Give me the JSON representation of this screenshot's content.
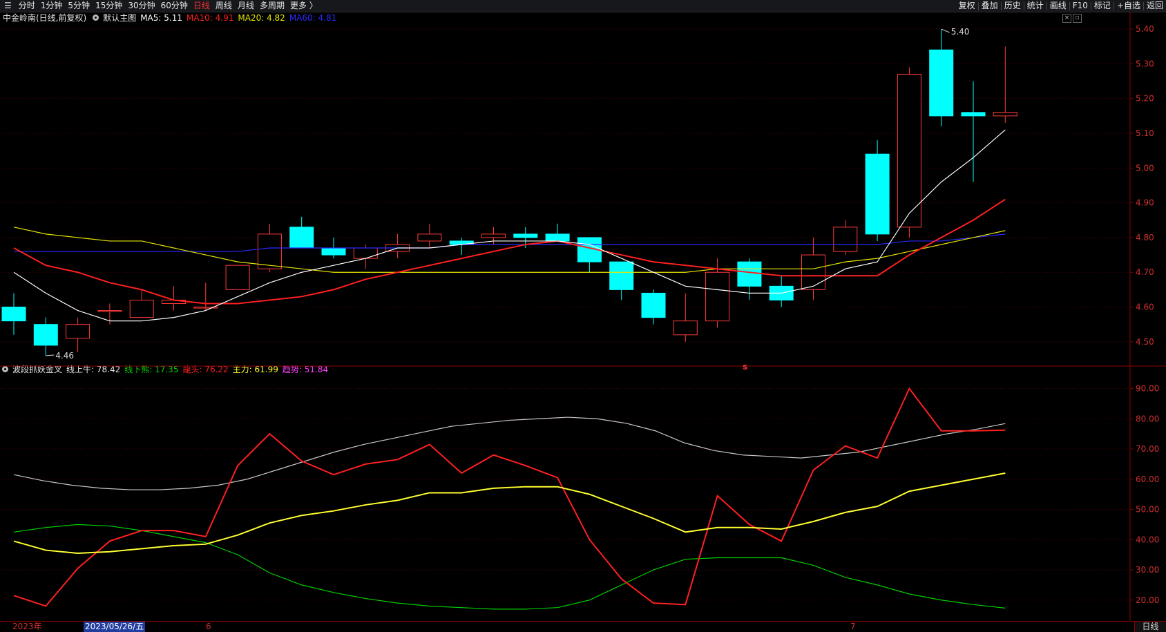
{
  "toolbar": {
    "periods": [
      "分时",
      "1分钟",
      "5分钟",
      "15分钟",
      "30分钟",
      "60分钟",
      "日线",
      "周线",
      "月线",
      "多周期",
      "更多 〉"
    ],
    "active_period": "日线",
    "tools": [
      "复权",
      "叠加",
      "历史",
      "统计",
      "画线",
      "F10",
      "标记",
      "+自选",
      "返回"
    ]
  },
  "main_panel": {
    "stock_label": "中金岭南(日线,前复权)",
    "indicator_name": "默认主图",
    "ma5": "MA5: 5.11",
    "ma10": "MA10: 4.91",
    "ma20": "MA20: 4.82",
    "ma60": "MA60: 4.81",
    "high_marker": "5.40",
    "low_marker": "4.46",
    "marker_s": "s",
    "y_ticks": [
      "5.40",
      "5.30",
      "5.20",
      "5.10",
      "5.00",
      "4.90",
      "4.80",
      "4.70",
      "4.60",
      "4.50"
    ]
  },
  "sub_panel": {
    "indicator_name": "波段抓妖金叉",
    "line_up": "线上牛: 78.42",
    "line_down": "线下熊: 17.35",
    "dragon_head": "龍头: 76.22",
    "main_force": "主力: 61.99",
    "trend": "趋势: 51.84",
    "y_ticks": [
      "90.00",
      "80.00",
      "70.00",
      "60.00",
      "50.00",
      "40.00",
      "30.00",
      "20.00"
    ]
  },
  "time_axis": {
    "year_label": "2023年",
    "cursor_date": "2023/05/26/五",
    "month_6": "6",
    "month_7": "7",
    "period_label": "日线"
  },
  "colors": {
    "up": "#ff3b3b",
    "down": "#00ffff",
    "ma5": "#ffffff",
    "ma10": "#ff2020",
    "ma20": "#e6e600",
    "ma60": "#2a2aff",
    "line_up": "#c8c8c8",
    "line_down": "#00d000",
    "dragon": "#ff2020",
    "main_force": "#ffff30",
    "trend": "#ff40ff"
  },
  "chart_data": [
    {
      "type": "candlestick",
      "title": "中金岭南(日线,前复权)",
      "ylim": [
        4.45,
        5.42
      ],
      "candles": [
        {
          "o": 4.6,
          "h": 4.64,
          "l": 4.52,
          "c": 4.56
        },
        {
          "o": 4.55,
          "h": 4.57,
          "l": 4.46,
          "c": 4.49
        },
        {
          "o": 4.51,
          "h": 4.57,
          "l": 4.47,
          "c": 4.55
        },
        {
          "o": 4.59,
          "h": 4.61,
          "l": 4.55,
          "c": 4.59
        },
        {
          "o": 4.57,
          "h": 4.65,
          "l": 4.57,
          "c": 4.62
        },
        {
          "o": 4.61,
          "h": 4.66,
          "l": 4.59,
          "c": 4.62
        },
        {
          "o": 4.6,
          "h": 4.67,
          "l": 4.59,
          "c": 4.6
        },
        {
          "o": 4.65,
          "h": 4.72,
          "l": 4.65,
          "c": 4.72
        },
        {
          "o": 4.71,
          "h": 4.84,
          "l": 4.7,
          "c": 4.81
        },
        {
          "o": 4.83,
          "h": 4.86,
          "l": 4.77,
          "c": 4.77
        },
        {
          "o": 4.77,
          "h": 4.8,
          "l": 4.74,
          "c": 4.75
        },
        {
          "o": 4.74,
          "h": 4.78,
          "l": 4.71,
          "c": 4.77
        },
        {
          "o": 4.76,
          "h": 4.81,
          "l": 4.74,
          "c": 4.78
        },
        {
          "o": 4.79,
          "h": 4.84,
          "l": 4.77,
          "c": 4.81
        },
        {
          "o": 4.79,
          "h": 4.8,
          "l": 4.75,
          "c": 4.78
        },
        {
          "o": 4.8,
          "h": 4.83,
          "l": 4.78,
          "c": 4.81
        },
        {
          "o": 4.81,
          "h": 4.83,
          "l": 4.77,
          "c": 4.8
        },
        {
          "o": 4.81,
          "h": 4.84,
          "l": 4.79,
          "c": 4.79
        },
        {
          "o": 4.8,
          "h": 4.8,
          "l": 4.7,
          "c": 4.73
        },
        {
          "o": 4.73,
          "h": 4.73,
          "l": 4.62,
          "c": 4.65
        },
        {
          "o": 4.64,
          "h": 4.65,
          "l": 4.55,
          "c": 4.57
        },
        {
          "o": 4.52,
          "h": 4.64,
          "l": 4.5,
          "c": 4.56
        },
        {
          "o": 4.56,
          "h": 4.74,
          "l": 4.54,
          "c": 4.7
        },
        {
          "o": 4.73,
          "h": 4.74,
          "l": 4.62,
          "c": 4.66
        },
        {
          "o": 4.66,
          "h": 4.69,
          "l": 4.6,
          "c": 4.62
        },
        {
          "o": 4.65,
          "h": 4.8,
          "l": 4.62,
          "c": 4.75
        },
        {
          "o": 4.76,
          "h": 4.85,
          "l": 4.75,
          "c": 4.83
        },
        {
          "o": 5.04,
          "h": 5.08,
          "l": 4.79,
          "c": 4.81
        },
        {
          "o": 4.83,
          "h": 5.29,
          "l": 4.8,
          "c": 5.27
        },
        {
          "o": 5.34,
          "h": 5.4,
          "l": 5.12,
          "c": 5.15
        },
        {
          "o": 5.16,
          "h": 5.25,
          "l": 4.96,
          "c": 5.15
        },
        {
          "o": 5.15,
          "h": 5.35,
          "l": 5.13,
          "c": 5.16
        }
      ],
      "ma5": [
        4.7,
        4.64,
        4.59,
        4.56,
        4.56,
        4.57,
        4.59,
        4.63,
        4.67,
        4.7,
        4.72,
        4.74,
        4.77,
        4.77,
        4.78,
        4.79,
        4.79,
        4.79,
        4.78,
        4.74,
        4.7,
        4.66,
        4.65,
        4.64,
        4.64,
        4.66,
        4.71,
        4.73,
        4.87,
        4.96,
        5.03,
        5.11
      ],
      "ma10": [
        4.77,
        4.72,
        4.7,
        4.67,
        4.65,
        4.62,
        4.61,
        4.61,
        4.62,
        4.63,
        4.65,
        4.68,
        4.7,
        4.72,
        4.74,
        4.76,
        4.78,
        4.79,
        4.77,
        4.75,
        4.73,
        4.72,
        4.71,
        4.7,
        4.69,
        4.69,
        4.69,
        4.69,
        4.75,
        4.8,
        4.85,
        4.91
      ],
      "ma20": [
        4.83,
        4.81,
        4.8,
        4.79,
        4.79,
        4.77,
        4.75,
        4.73,
        4.72,
        4.71,
        4.7,
        4.7,
        4.7,
        4.7,
        4.7,
        4.7,
        4.7,
        4.7,
        4.7,
        4.7,
        4.7,
        4.7,
        4.71,
        4.71,
        4.71,
        4.71,
        4.73,
        4.74,
        4.76,
        4.78,
        4.8,
        4.82
      ],
      "ma60": [
        4.76,
        4.76,
        4.76,
        4.76,
        4.76,
        4.76,
        4.76,
        4.76,
        4.77,
        4.77,
        4.77,
        4.77,
        4.77,
        4.77,
        4.78,
        4.78,
        4.78,
        4.78,
        4.78,
        4.78,
        4.78,
        4.78,
        4.78,
        4.78,
        4.78,
        4.78,
        4.78,
        4.78,
        4.79,
        4.79,
        4.8,
        4.81
      ]
    },
    {
      "type": "line",
      "title": "波段抓妖金叉",
      "ylim": [
        14,
        94
      ],
      "series": [
        {
          "name": "线上牛",
          "values": [
            61.5,
            59.5,
            58,
            57,
            56.5,
            56.5,
            57,
            58,
            60,
            63,
            66,
            69,
            71.5,
            73.5,
            75.5,
            77.5,
            78.5,
            79.5,
            80,
            80.5,
            80,
            78.5,
            76,
            72,
            69.5,
            68,
            67.5,
            67,
            68,
            69,
            71,
            73,
            75,
            76.5,
            78.42
          ]
        },
        {
          "name": "线下熊",
          "values": [
            42.5,
            44,
            45,
            44.5,
            43,
            41,
            39,
            35,
            29,
            25,
            22.5,
            20.5,
            19,
            18,
            17.5,
            17,
            17,
            17.5,
            20,
            25,
            30,
            33.5,
            34,
            34,
            34,
            31.5,
            27.5,
            25,
            22,
            20,
            18.5,
            17.35
          ]
        },
        {
          "name": "龍头",
          "values": [
            21.5,
            18,
            30.5,
            39.5,
            43,
            43,
            41,
            64.5,
            75,
            66,
            61.5,
            65,
            66.5,
            71.5,
            62,
            68,
            64.5,
            60.5,
            40,
            27,
            19,
            18.5,
            54.5,
            45,
            39.5,
            63,
            71,
            67,
            90,
            76,
            76,
            76.22
          ]
        },
        {
          "name": "主力",
          "values": [
            39.5,
            36.5,
            35.5,
            36,
            37,
            38,
            38.5,
            41.5,
            45.5,
            48,
            49.5,
            51.5,
            53,
            55.5,
            55.5,
            57,
            57.5,
            57.5,
            55,
            51,
            47,
            42.5,
            44,
            44,
            43.5,
            46,
            49,
            51,
            56,
            58,
            60,
            61.99
          ]
        }
      ]
    }
  ]
}
